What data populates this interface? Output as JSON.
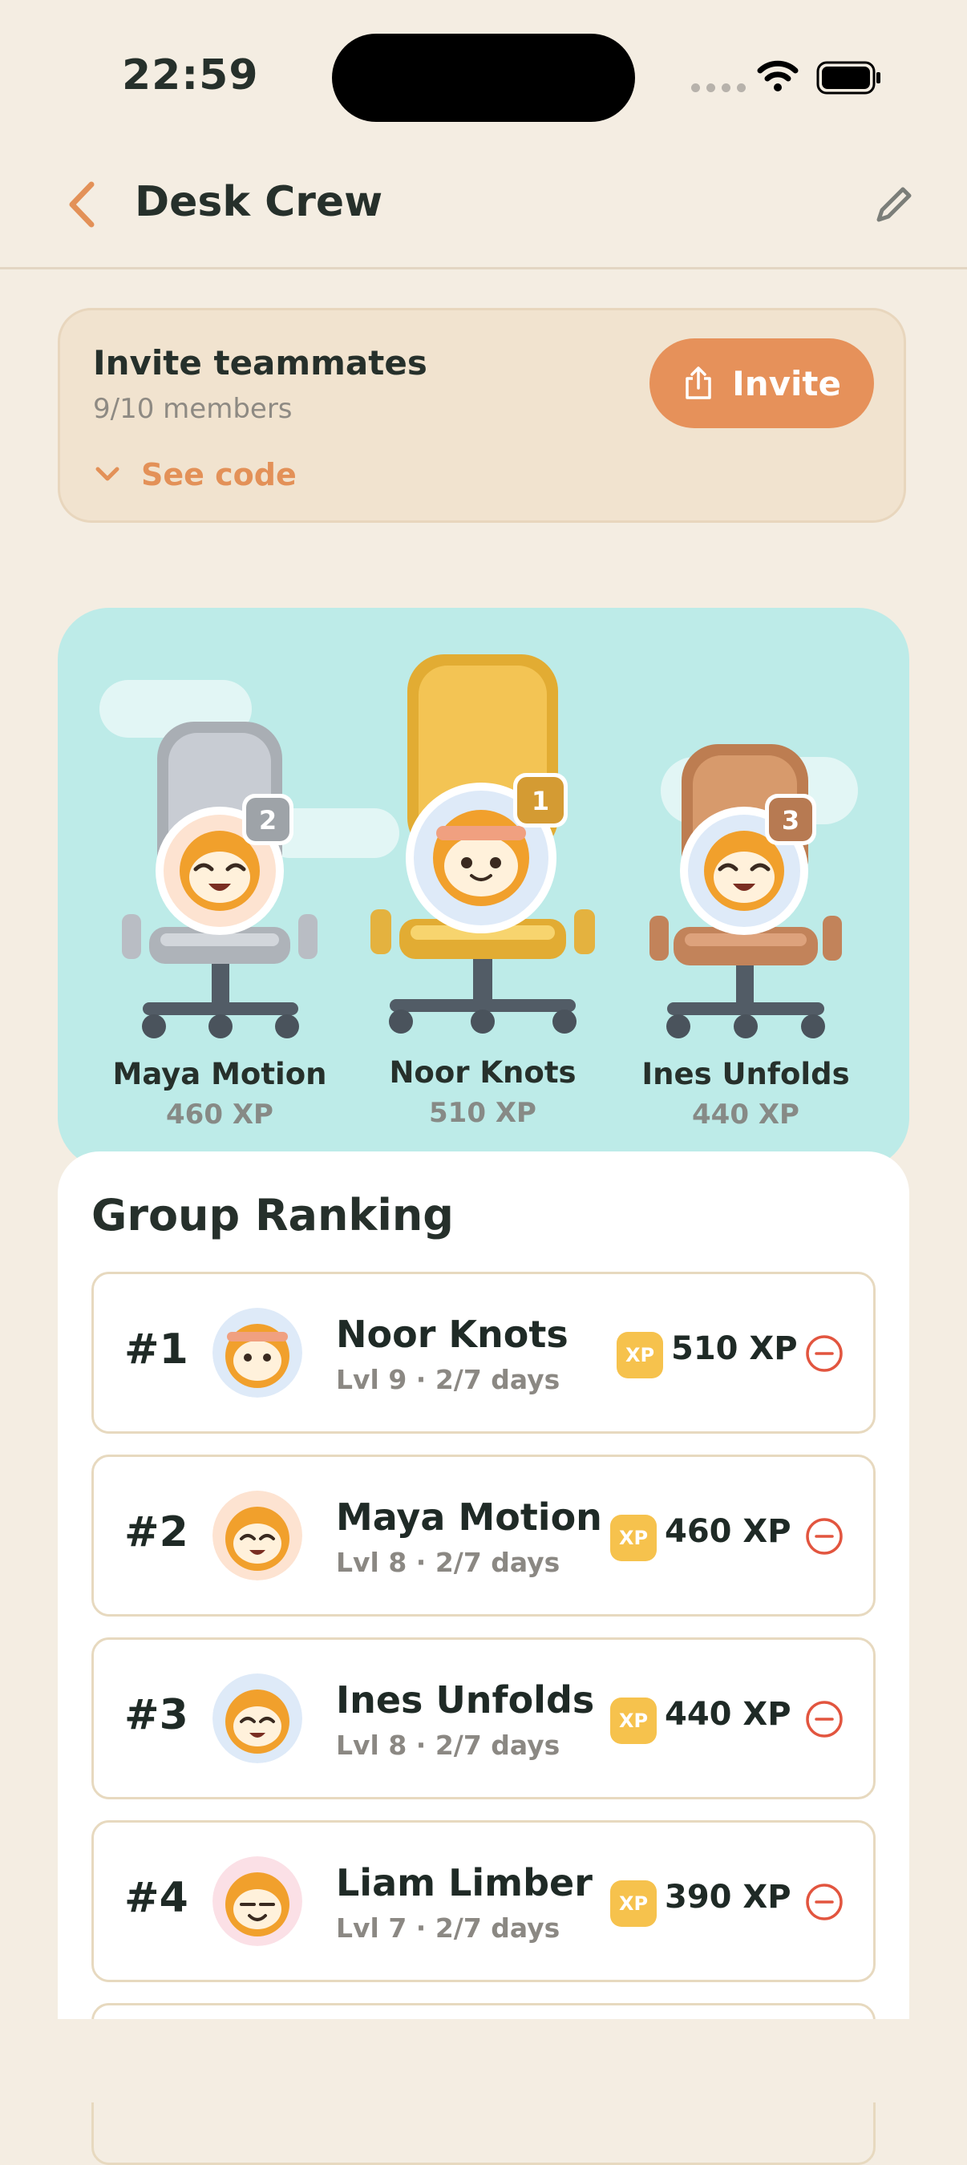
{
  "status": {
    "time": "22:59"
  },
  "nav": {
    "title": "Desk Crew",
    "back_icon": "chevron-left-icon",
    "edit_icon": "pencil-icon"
  },
  "invite": {
    "title": "Invite teammates",
    "members": "9/10 members",
    "see_code": "See code",
    "button": "Invite"
  },
  "podium": [
    {
      "place": "2",
      "name": "Maya Motion",
      "xp": "460 XP"
    },
    {
      "place": "1",
      "name": "Noor Knots",
      "xp": "510 XP"
    },
    {
      "place": "3",
      "name": "Ines Unfolds",
      "xp": "440 XP"
    }
  ],
  "ranking": {
    "title": "Group Ranking",
    "xp_badge": "XP",
    "rows": [
      {
        "rank": "#1",
        "name": "Noor Knots",
        "meta": "Lvl 9 · 2/7 days",
        "xp": "510 XP"
      },
      {
        "rank": "#2",
        "name": "Maya Motion",
        "meta": "Lvl 8 · 2/7 days",
        "xp": "460 XP"
      },
      {
        "rank": "#3",
        "name": "Ines Unfolds",
        "meta": "Lvl 8 · 2/7 days",
        "xp": "440 XP"
      },
      {
        "rank": "#4",
        "name": "Liam Limber",
        "meta": "Lvl 7 · 2/7 days",
        "xp": "390 XP"
      }
    ]
  },
  "colors": {
    "accent": "#e6915a",
    "podium_bg": "#bdebe8",
    "gold": "#f3c454",
    "silver": "#c8ccd3",
    "bronze": "#d79a6c",
    "remove": "#e2553f"
  }
}
